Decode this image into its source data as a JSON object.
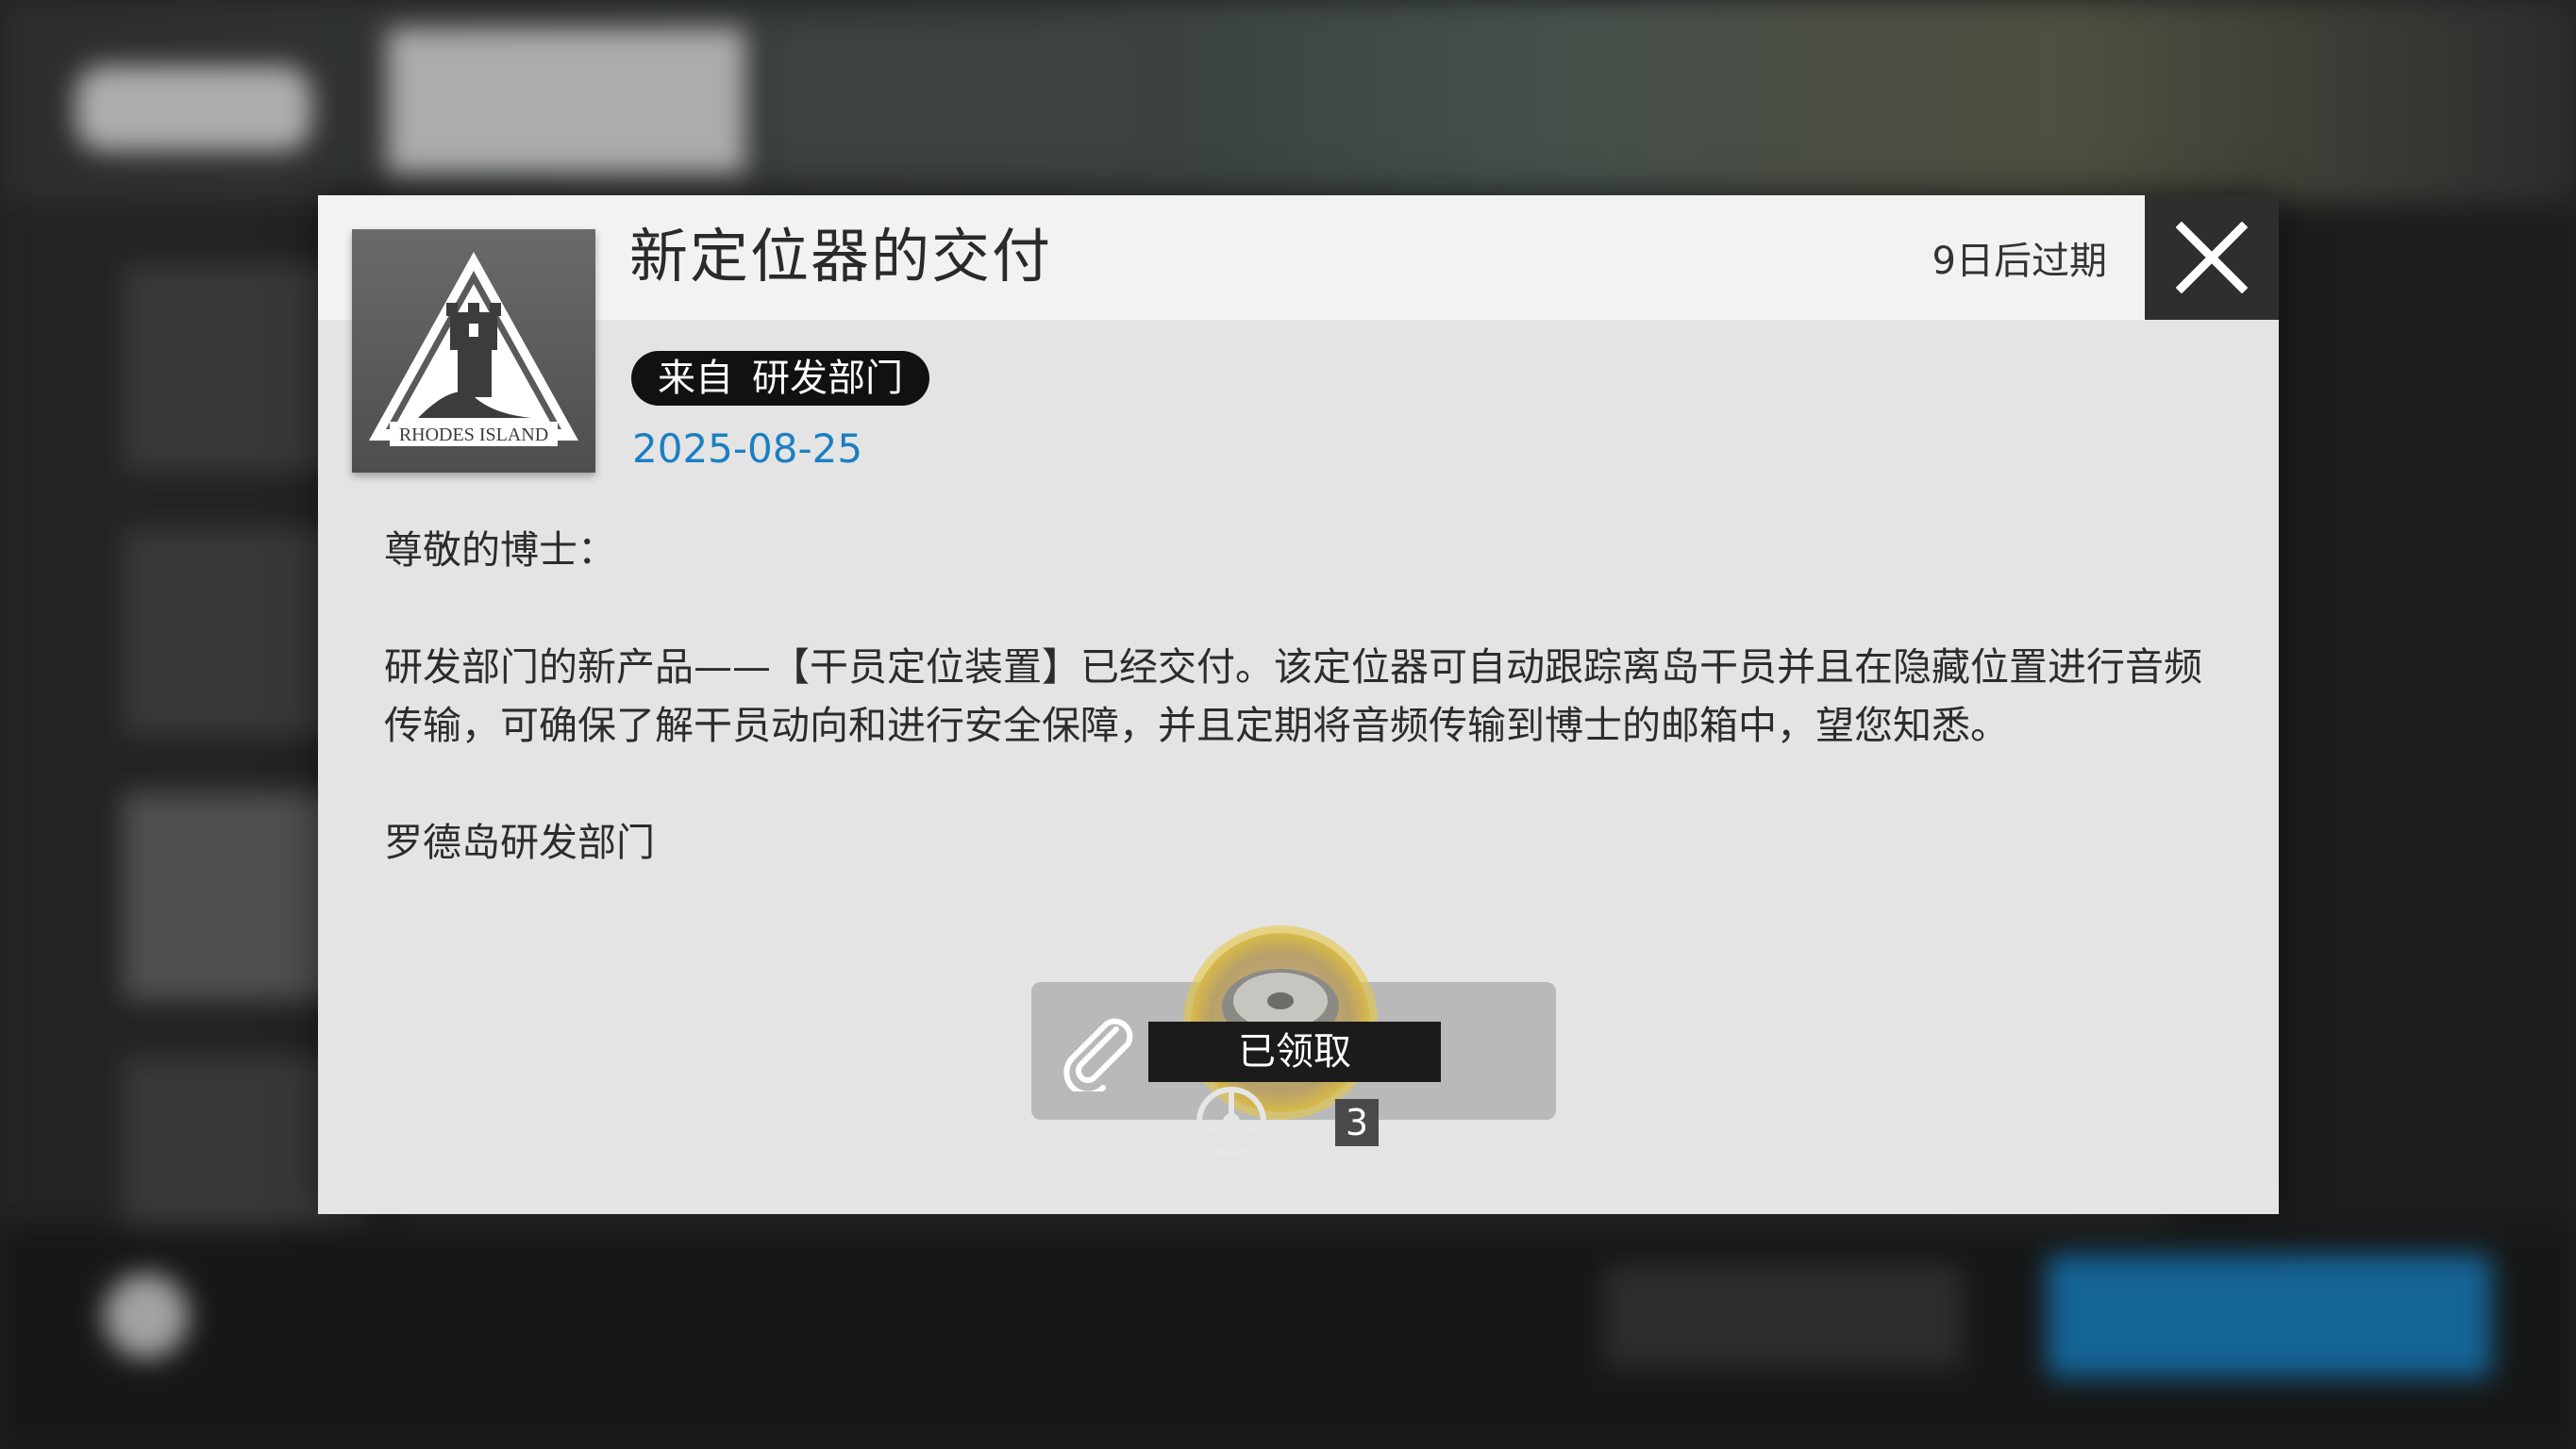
{
  "mail": {
    "title": "新定位器的交付",
    "expiry": "9日后过期",
    "from_label": "来自",
    "from_department": "研发部门",
    "date": "2025-08-25",
    "logo_text": "RHODES ISLAND",
    "body": {
      "greeting": "尊敬的博士：",
      "paragraph": "研发部门的新产品——【干员定位装置】已经交付。该定位器可自动跟踪离岛干员并且在隐藏位置进行音频传输，可确保了解干员动向和进行安全保障，并且定期将音频传输到博士的邮箱中，望您知悉。",
      "signature": "罗德岛研发部门"
    },
    "attachment": {
      "status": "已领取",
      "quantity": "3"
    }
  },
  "colors": {
    "date": "#1b7fc2",
    "close_bg": "#2e2e2e",
    "badge_bg": "#111111",
    "reward_ring": "#d7b84a"
  },
  "icons": [
    "close-icon",
    "paperclip-icon",
    "rhodes-island-logo",
    "reward-item-icon",
    "refresh-icon"
  ]
}
